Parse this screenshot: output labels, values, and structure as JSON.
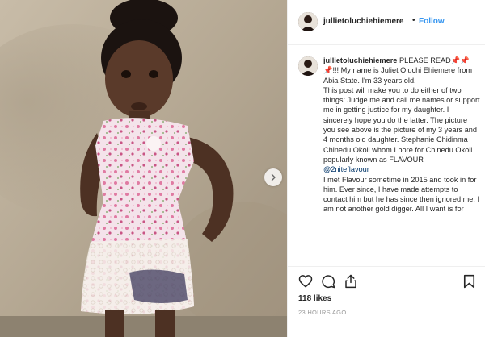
{
  "header": {
    "username": "jullietoluchiehiemere",
    "separator": "•",
    "follow_label": "Follow"
  },
  "caption": {
    "username": "jullietoluchiehiemere",
    "paragraphs": [
      "PLEASE READ📌📌📌!!! My name is Juliet Oluchi Ehiemere from Abia State. I'm 33 years old.",
      "This post will make you to do either of two things: Judge me and call me names or support me in getting justice for my daughter. I sincerely hope you do the latter. The picture you see above is the picture of my 3 years and 4 months old daughter. Stephanie Chidinma Chinedu Okoli whom I bore for Chinedu Okoli popularly known as FLAVOUR",
      "I met Flavour sometime in 2015 and took in for him. Ever since, I have made attempts to contact him but he has since then ignored me. I am not another gold digger. All I want is for"
    ],
    "mention": "@2niteflavour"
  },
  "actions": {
    "like_icon": "heart-outline-icon",
    "comment_icon": "comment-icon",
    "share_icon": "share-upload-icon",
    "save_icon": "bookmark-icon"
  },
  "likes_text": "118 likes",
  "timestamp": "23 HOURS AGO",
  "carousel": {
    "next_icon": "chevron-right-icon"
  }
}
